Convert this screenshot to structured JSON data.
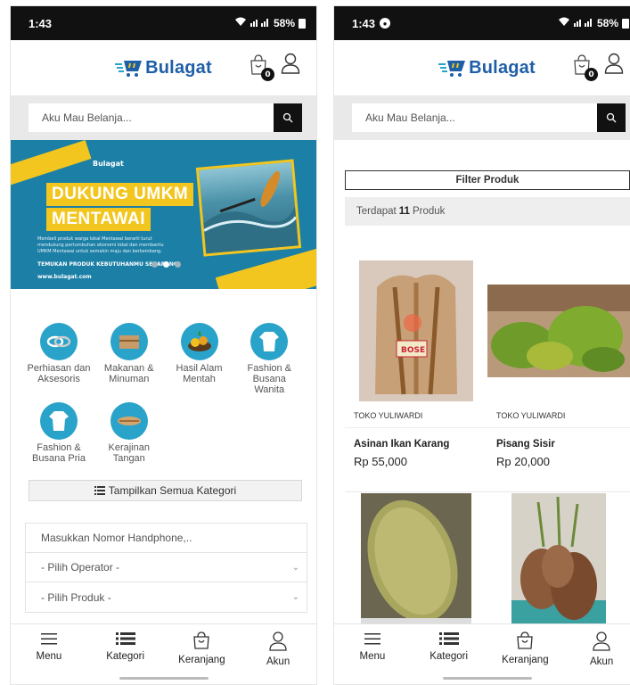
{
  "left": {
    "status": {
      "time": "1:43",
      "battery": "58%"
    },
    "brand": "Bulagat",
    "cart_count": "0",
    "search": {
      "placeholder": "Aku Mau Belanja..."
    },
    "banner": {
      "logo_text": "Bulagat",
      "headline_1": "DUKUNG UMKM",
      "headline_2": "MENTAWAI",
      "description": "Membeli produk warga lokal Mentawai berarti turut mendukung pertumbuhan ekonomi lokal dan membantu UMKM Mentawai untuk semakin maju dan berkembang.",
      "cta": "TEMUKAN PRODUK KEBUTUHANMU SEKARANG!",
      "url": "www.bulagat.com",
      "slide_index": 1,
      "slide_count": 3
    },
    "categories": [
      {
        "label": "Perhiasan dan Aksesoris",
        "icon": "jewelry-icon"
      },
      {
        "label": "Makanan & Minuman",
        "icon": "food-icon"
      },
      {
        "label": "Hasil Alam Mentah",
        "icon": "produce-icon"
      },
      {
        "label": "Fashion & Busana Wanita",
        "icon": "women-fashion-icon"
      },
      {
        "label": "Fashion & Busana Pria",
        "icon": "men-fashion-icon"
      },
      {
        "label": "Kerajinan Tangan",
        "icon": "craft-icon"
      }
    ],
    "all_categories_label": "Tampilkan Semua Kategori",
    "topup": {
      "phone_placeholder": "Masukkan Nomor Handphone,..",
      "operator_label": "- Pilih Operator -",
      "product_label": "- Pilih Produk -"
    }
  },
  "right": {
    "status": {
      "time": "1:43",
      "battery": "58%"
    },
    "brand": "Bulagat",
    "cart_count": "0",
    "search": {
      "placeholder": "Aku Mau Belanja..."
    },
    "filter_label": "Filter Produk",
    "count": {
      "prefix": "Terdapat",
      "number": "11",
      "suffix": "Produk"
    },
    "products": [
      {
        "shop": "TOKO YULIWARDI",
        "name": "Asinan Ikan Karang",
        "price": "Rp 55,000"
      },
      {
        "shop": "TOKO YULIWARDI",
        "name": "Pisang Sisir",
        "price": "Rp 20,000"
      },
      {
        "shop": "",
        "name": "",
        "price": ""
      },
      {
        "shop": "",
        "name": "",
        "price": ""
      }
    ]
  },
  "nav": [
    {
      "label": "Menu",
      "icon": "hamburger-icon"
    },
    {
      "label": "Kategori",
      "icon": "category-list-icon"
    },
    {
      "label": "Keranjang",
      "icon": "shopping-bag-icon"
    },
    {
      "label": "Akun",
      "icon": "user-icon"
    }
  ],
  "colors": {
    "brand_blue": "#1f5fa8",
    "accent_cyan": "#29a3c9",
    "banner_yellow": "#f2c61f",
    "banner_blue": "#1c7fa6"
  }
}
